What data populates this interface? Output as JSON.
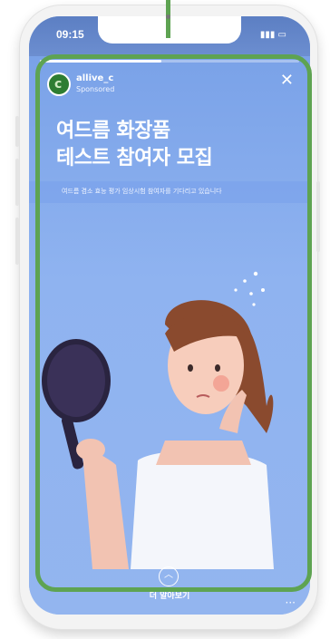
{
  "status": {
    "time": "09:15"
  },
  "ad": {
    "account": "allive_c",
    "sponsored": "Sponsored",
    "title_line1": "여드름 화장품",
    "title_line2": "테스트 참여자 모집",
    "subtitle": "여드름 겸소 효능 평가 임상시험 참여자를 기다리고 있습니다",
    "learn_more": "더 알아보기",
    "progress_fraction": 0.47
  },
  "icons": [
    "close-icon",
    "chevron-up-icon",
    "more-icon",
    "signal-icon",
    "battery-icon",
    "brand-logo-icon"
  ],
  "colors": {
    "highlight": "#5ea352",
    "background": "#8db1ef",
    "accent": "#ffffff"
  }
}
